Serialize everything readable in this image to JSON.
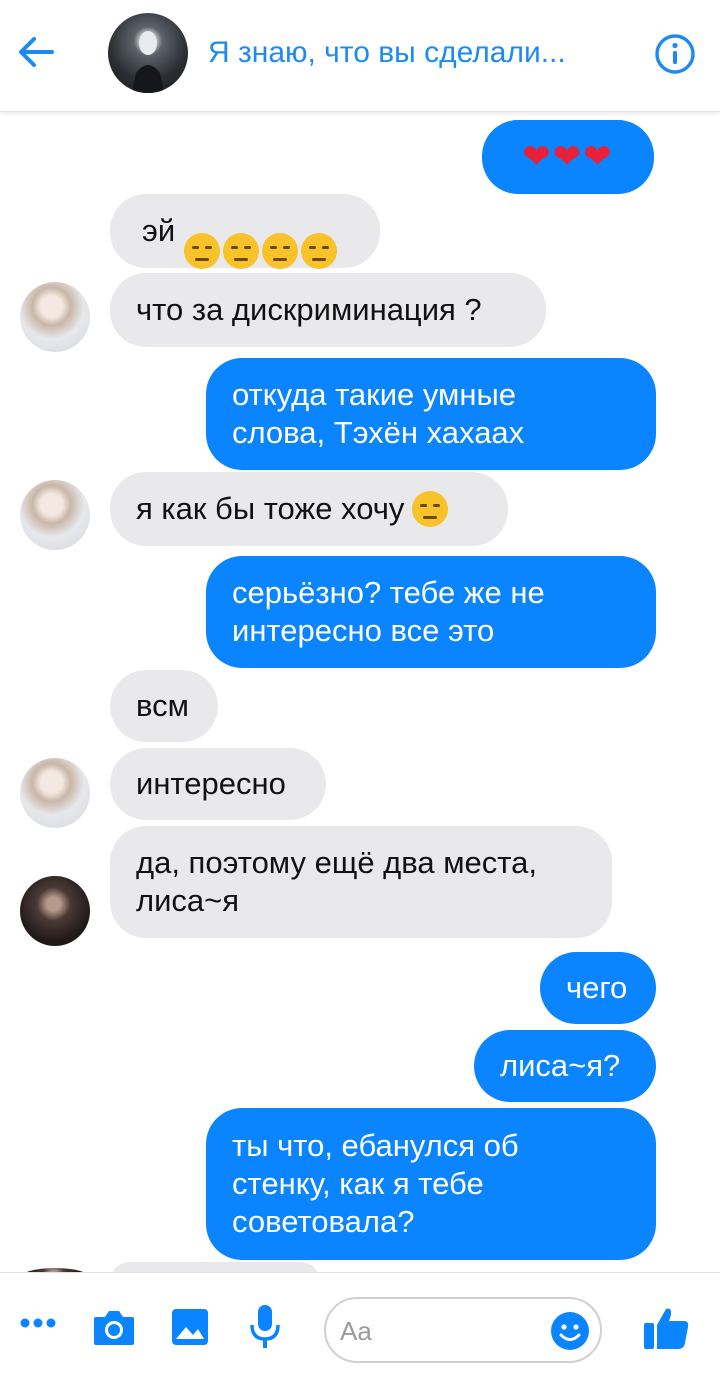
{
  "header": {
    "title": "Я знаю, что вы сделали...",
    "back_icon": "arrow-left-icon",
    "info_icon": "info-icon"
  },
  "messages": [
    {
      "side": "out",
      "text": "❤❤❤",
      "type": "hearts"
    },
    {
      "side": "in",
      "text": "эй",
      "emoji": "unamused-x4"
    },
    {
      "side": "in",
      "text": "что за дискриминация ?"
    },
    {
      "side": "out",
      "text": "откуда такие умные\nслова, Тэхён хахаах"
    },
    {
      "side": "in",
      "text": "я как бы тоже хочу"
    },
    {
      "side": "out",
      "text": "серьёзно? тебе же не\nинтересно все это"
    },
    {
      "side": "in",
      "text": "всм"
    },
    {
      "side": "in",
      "text": "интересно"
    },
    {
      "side": "in",
      "text": "да, поэтому ещё два места,\nлиса~я"
    },
    {
      "side": "out",
      "text": "чего"
    },
    {
      "side": "out",
      "text": "лиса~я?"
    },
    {
      "side": "out",
      "text": "ты что, ебанулся об\nстенку, как я тебе\nсоветовала?"
    }
  ],
  "composer": {
    "placeholder": "Aa",
    "icons": [
      "more-icon",
      "camera-icon",
      "image-icon",
      "microphone-icon",
      "smile-icon",
      "thumbs-up-icon"
    ]
  },
  "colors": {
    "accent": "#0a84ff",
    "incoming_bubble": "#e9e9ec",
    "header_text": "#1d8af2"
  }
}
